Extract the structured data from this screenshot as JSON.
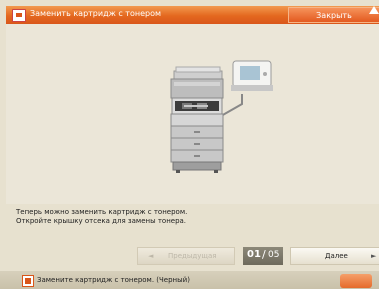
{
  "header": {
    "title": "Заменить картридж с тонером",
    "close_label": "Закрыть"
  },
  "message": {
    "line1": "Теперь можно заменить картридж с тонером.",
    "line2": "Откройте крышку отсека для замены тонера."
  },
  "navigation": {
    "prev_label": "Предыдущая",
    "next_label": "Далее",
    "page_current": "01",
    "page_separator": "/",
    "page_total": "05"
  },
  "status": {
    "text": "Замените картридж с тонером. (Черный)"
  }
}
